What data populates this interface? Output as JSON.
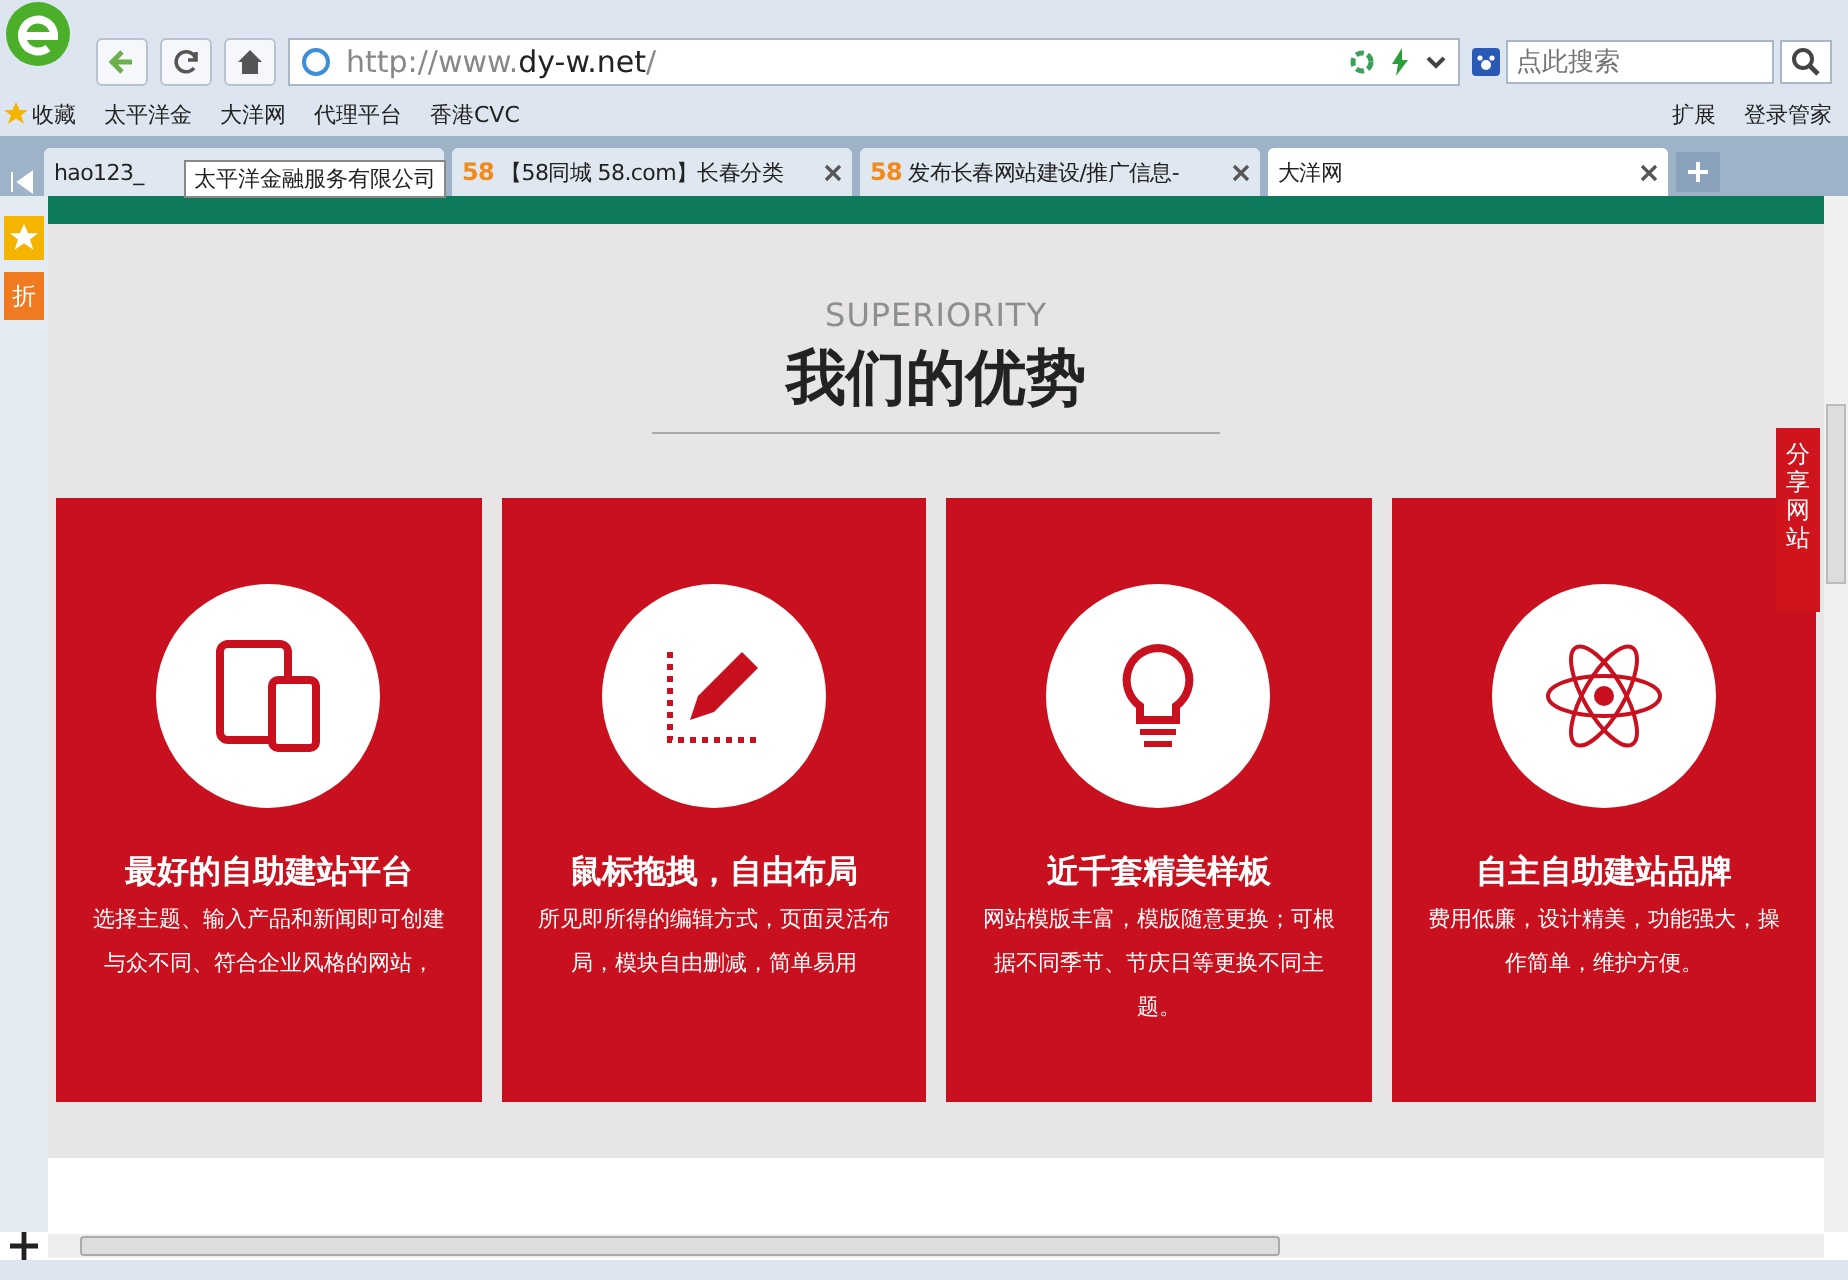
{
  "address": {
    "url_prefix": "http://www.",
    "url_host": "dy-w.net",
    "url_suffix": "/"
  },
  "search": {
    "placeholder": "点此搜索"
  },
  "bookmarks": {
    "favorites": "收藏",
    "items": [
      "太平洋金",
      "大洋网",
      "代理平台",
      "香港CVC"
    ],
    "extensions": "扩展",
    "login": "登录管家"
  },
  "tabs": [
    {
      "label": "hao123_",
      "selected": false,
      "closable": false
    },
    {
      "label": "【58同城 58.com】长春分类",
      "badge": "58",
      "selected": false,
      "closable": true
    },
    {
      "label": "发布长春网站建设/推广信息-",
      "badge": "58",
      "selected": false,
      "closable": true
    },
    {
      "label": "大洋网",
      "selected": true,
      "closable": true
    }
  ],
  "tooltip": "太平洋金融服务有限公司",
  "sidebar": {
    "discount": "折"
  },
  "page": {
    "subtitle": "SUPERIORITY",
    "title": "我们的优势",
    "share": "分享网站",
    "cards": [
      {
        "kind": "devices",
        "title": "最好的自助建站平台",
        "text": "选择主题、输入产品和新闻即可创建与众不同、符合企业风格的网站，"
      },
      {
        "kind": "pencil",
        "title": "鼠标拖拽，自由布局",
        "text": "所见即所得的编辑方式，页面灵活布局，模块自由删减，简单易用"
      },
      {
        "kind": "bulb",
        "title": "近千套精美样板",
        "text": "网站模版丰富，模版随意更换；可根据不同季节、节庆日等更换不同主题。"
      },
      {
        "kind": "atom",
        "title": "自主自助建站品牌",
        "text": "费用低廉，设计精美，功能强大，操作简单，维护方便。"
      }
    ]
  }
}
